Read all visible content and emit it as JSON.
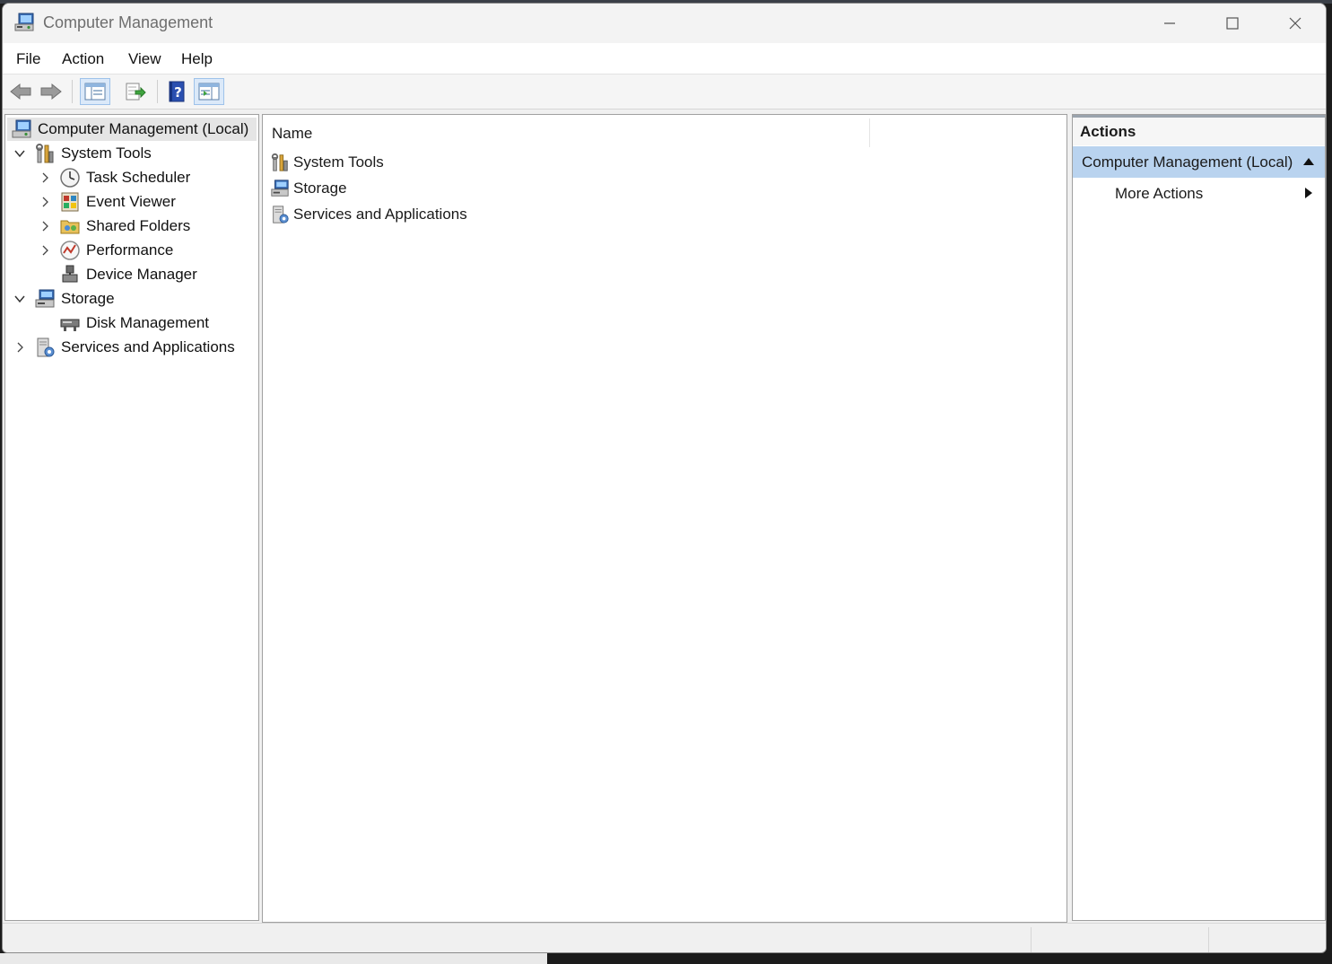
{
  "window": {
    "title": "Computer Management"
  },
  "menu": {
    "items": [
      "File",
      "Action",
      "View",
      "Help"
    ]
  },
  "toolbar": {
    "buttons": [
      {
        "icon": "back-arrow-icon"
      },
      {
        "icon": "forward-arrow-icon"
      },
      {
        "icon": "show-hide-console-tree-icon",
        "active": true
      },
      {
        "icon": "export-list-icon"
      },
      {
        "icon": "help-icon"
      },
      {
        "icon": "show-hide-action-pane-icon",
        "active": true
      }
    ]
  },
  "tree": {
    "root": "Computer Management (Local)",
    "items": [
      {
        "label": "System Tools",
        "expanded": true
      },
      {
        "label": "Task Scheduler"
      },
      {
        "label": "Event Viewer"
      },
      {
        "label": "Shared Folders"
      },
      {
        "label": "Performance"
      },
      {
        "label": "Device Manager"
      },
      {
        "label": "Storage",
        "expanded": true
      },
      {
        "label": "Disk Management"
      },
      {
        "label": "Services and Applications"
      }
    ]
  },
  "list": {
    "column": "Name",
    "rows": [
      "System Tools",
      "Storage",
      "Services and Applications"
    ]
  },
  "actions": {
    "header": "Actions",
    "selected": "Computer Management (Local)",
    "more": "More Actions"
  },
  "colors": {
    "selection": "#b9d3ef",
    "toolbar_active": "#dbe9f9"
  }
}
